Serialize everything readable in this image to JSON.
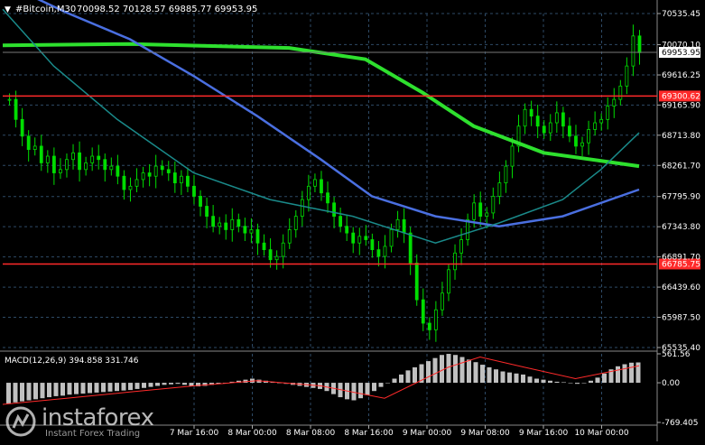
{
  "header": {
    "symbol": "#Bitcoin,M30",
    "ohlc": "70098.52 70128.57 69885.77 69953.95"
  },
  "macd": {
    "label": "MACD(12,26,9) 394.858 331.746",
    "price_labels": [
      "561.56",
      "0.00",
      "-769.405"
    ]
  },
  "watermark": {
    "name": "instaforex",
    "tagline": "Instant Forex Trading"
  },
  "colors": {
    "background": "#000000",
    "grid": "#2e4a66",
    "axis_text": "#ffffff",
    "bull": "#00dd00",
    "bear": "#00dd00",
    "ma_fast": "#1a8a8a",
    "ma_mid": "#4a6fe0",
    "ma_slow": "#2ee02e",
    "level_line": "#ff2a2a",
    "level_label_bg": "#ff2a2a",
    "histogram": "#c0c0c0",
    "signal": "#ff2a2a"
  },
  "chart_data": {
    "type": "candlestick",
    "symbol": "#Bitcoin",
    "timeframe": "M30",
    "y_ticks": [
      "70535.45",
      "70070.10",
      "69616.25",
      "69165.90",
      "68713.80",
      "68261.70",
      "67795.90",
      "67343.80",
      "66891.70",
      "66439.60",
      "65987.50",
      "65535.40"
    ],
    "ylim": [
      65535.4,
      70535.45
    ],
    "x_ticks": [
      "7 Mar 16:00",
      "8 Mar 00:00",
      "8 Mar 08:00",
      "8 Mar 16:00",
      "9 Mar 00:00",
      "9 Mar 08:00",
      "9 Mar 16:00",
      "10 Mar 00:00"
    ],
    "current_price": "69953.95",
    "levels": [
      {
        "label": "69300.62",
        "value": 69300.62
      },
      {
        "label": "66785.75",
        "value": 66785.75
      }
    ],
    "candles": [
      69250,
      68950,
      68700,
      68500,
      68550,
      68300,
      68400,
      68150,
      68200,
      68350,
      68450,
      68200,
      68300,
      68400,
      68350,
      68200,
      68250,
      68100,
      67900,
      67950,
      68050,
      68150,
      68100,
      68250,
      68200,
      68150,
      68000,
      68100,
      67950,
      67800,
      67650,
      67500,
      67350,
      67400,
      67300,
      67450,
      67350,
      67250,
      67300,
      67100,
      67000,
      66850,
      66900,
      67100,
      67300,
      67500,
      67750,
      67950,
      68050,
      67850,
      67700,
      67500,
      67350,
      67250,
      67100,
      67200,
      67150,
      67000,
      66900,
      67050,
      67300,
      67450,
      67250,
      66800,
      66250,
      65900,
      65800,
      66100,
      66350,
      66700,
      66950,
      67150,
      67450,
      67700,
      67500,
      67550,
      67800,
      68000,
      68250,
      68550,
      68850,
      69100,
      69000,
      68850,
      68750,
      68900,
      69050,
      68850,
      68700,
      68550,
      68600,
      68800,
      68900,
      68950,
      69150,
      69250,
      69450,
      69750,
      70200,
      69950
    ],
    "moving_averages": [
      {
        "color_key": "ma_slow",
        "points": [
          [
            0,
            70060
          ],
          [
            0.2,
            70080
          ],
          [
            0.45,
            70020
          ],
          [
            0.57,
            69850
          ],
          [
            0.66,
            69350
          ],
          [
            0.74,
            68850
          ],
          [
            0.85,
            68450
          ],
          [
            1,
            68250
          ]
        ]
      },
      {
        "color_key": "ma_mid",
        "points": [
          [
            0,
            71000
          ],
          [
            0.1,
            70550
          ],
          [
            0.2,
            70150
          ],
          [
            0.3,
            69600
          ],
          [
            0.4,
            69000
          ],
          [
            0.5,
            68350
          ],
          [
            0.58,
            67800
          ],
          [
            0.68,
            67500
          ],
          [
            0.78,
            67350
          ],
          [
            0.88,
            67500
          ],
          [
            1,
            67900
          ]
        ]
      },
      {
        "color_key": "ma_fast",
        "points": [
          [
            0,
            70600
          ],
          [
            0.08,
            69750
          ],
          [
            0.18,
            68950
          ],
          [
            0.3,
            68150
          ],
          [
            0.42,
            67750
          ],
          [
            0.55,
            67500
          ],
          [
            0.68,
            67100
          ],
          [
            0.78,
            67400
          ],
          [
            0.88,
            67750
          ],
          [
            0.94,
            68200
          ],
          [
            1,
            68750
          ]
        ]
      }
    ],
    "macd": {
      "ylim": [
        -769.405,
        561.56
      ],
      "histogram": [
        -400,
        -380,
        -360,
        -340,
        -320,
        -300,
        -280,
        -260,
        -250,
        -230,
        -220,
        -210,
        -200,
        -190,
        -180,
        -170,
        -160,
        -150,
        -140,
        -120,
        -100,
        -80,
        -60,
        -40,
        -30,
        -20,
        -40,
        -60,
        -70,
        -60,
        -40,
        -20,
        0,
        20,
        40,
        60,
        80,
        60,
        40,
        20,
        0,
        -20,
        -40,
        -60,
        -80,
        -100,
        -120,
        -160,
        -220,
        -280,
        -320,
        -340,
        -300,
        -240,
        -160,
        -80,
        0,
        80,
        160,
        240,
        300,
        360,
        420,
        480,
        540,
        561,
        540,
        500,
        450,
        400,
        350,
        300,
        260,
        220,
        200,
        180,
        160,
        120,
        80,
        60,
        40,
        20,
        10,
        0,
        -20,
        0,
        40,
        100,
        180,
        260,
        320,
        360,
        390,
        395
      ],
      "signal": [
        [
          0,
          -420
        ],
        [
          0.1,
          -300
        ],
        [
          0.2,
          -180
        ],
        [
          0.3,
          -60
        ],
        [
          0.4,
          40
        ],
        [
          0.5,
          -60
        ],
        [
          0.6,
          -300
        ],
        [
          0.7,
          300
        ],
        [
          0.75,
          500
        ],
        [
          0.82,
          300
        ],
        [
          0.9,
          80
        ],
        [
          1,
          331
        ]
      ]
    }
  }
}
